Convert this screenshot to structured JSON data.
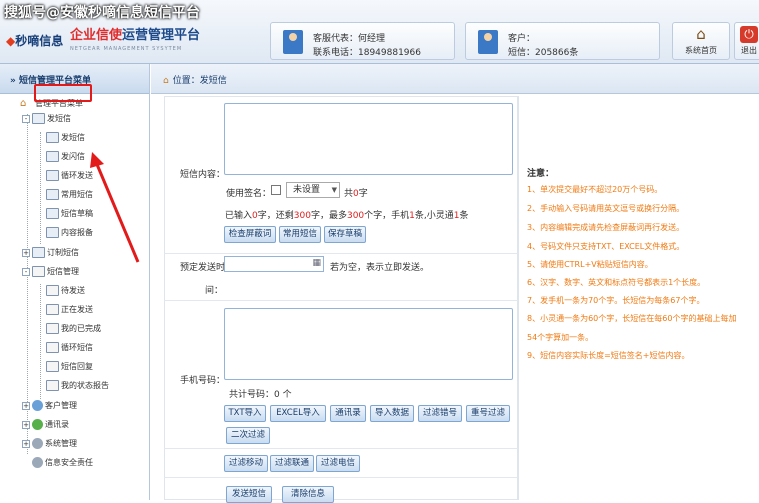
{
  "watermark": "搜狐号@安徽秒嘀信息短信平台",
  "header": {
    "logo": "秒嘀信息",
    "brand_prefix": "企业信使",
    "brand_suffix": "运营管理平台",
    "brand_en": "NETGEAR MANAGEMENT SYSYTEM",
    "service_rep": "客服代表：何经理",
    "service_phone": "联系电话：18949881966",
    "customer": "客户：",
    "balance": "短信：205866条",
    "home_label": "系统首页",
    "logout_label": "退出"
  },
  "sidebar": {
    "title": "» 短信管理平台菜单",
    "root": "管理平台菜单",
    "send_group": "发短信",
    "items": [
      "发短信",
      "发闪信",
      "循环发送",
      "常用短信",
      "短信草稿",
      "内容报备"
    ],
    "subscribe": "订制短信",
    "sms_manage": "短信管理",
    "manage_items": [
      "待发送",
      "正在发送",
      "我的已完成",
      "循环短信",
      "短信回复",
      "我的状态报告"
    ],
    "customer_mgmt": "客户管理",
    "contacts": "通讯录",
    "system": "系统管理",
    "security": "信息安全责任"
  },
  "breadcrumb": "位置：发短信",
  "form": {
    "content_label": "短信内容：",
    "sign_label": "使用签名：",
    "sign_select": "未设置",
    "total_prefix": "共",
    "total_num": "0",
    "total_suffix": "字",
    "count_a": "已输入",
    "count_b": "0",
    "count_c": "字，还剩",
    "count_d": "300",
    "count_e": "字，最多",
    "count_f": "300",
    "count_g": "个字，手机",
    "count_h": "1",
    "count_i": "条,小灵通",
    "count_j": "1",
    "count_k": "条",
    "btn_check": "检查屏蔽词",
    "btn_common": "常用短信",
    "btn_draft": "保存草稿",
    "schedule_label1": "预定发送时",
    "schedule_label2": "间：",
    "schedule_hint": "若为空，表示立即发送。",
    "phone_label": "手机号码：",
    "phone_count": "共计号码：0 个",
    "btns1": [
      "TXT导入",
      "EXCEL导入",
      "通讯录",
      "导入数据",
      "过滤错号",
      "重号过滤"
    ],
    "btn_second": "二次过滤",
    "btns2": [
      "过滤移动",
      "过滤联通",
      "过滤电信"
    ],
    "btn_send": "发送短信",
    "btn_clear": "清除信息"
  },
  "notes": {
    "title": "注意：",
    "lines": [
      "1、单次提交最好不超过20万个号码。",
      "2、手动输入号码请用英文逗号或换行分隔。",
      "3、内容编辑完成请先检查屏蔽词再行发送。",
      "4、号码文件只支持TXT、EXCEL文件格式。",
      "5、请使用CTRL+V粘贴短信内容。",
      "6、汉字、数字、英文和标点符号都表示1个长度。",
      "7、发手机一条为70个字。长短信为每条67个字。",
      "8、小灵通一条为60个字，长短信在每60个字的基础上每加",
      "54个字算加一条。",
      "9、短信内容实际长度=短信签名+短信内容。"
    ]
  },
  "colors": {
    "highlight": "#e31a1a",
    "notes_text": "#f07a12",
    "accent": "#1a3f6e"
  }
}
